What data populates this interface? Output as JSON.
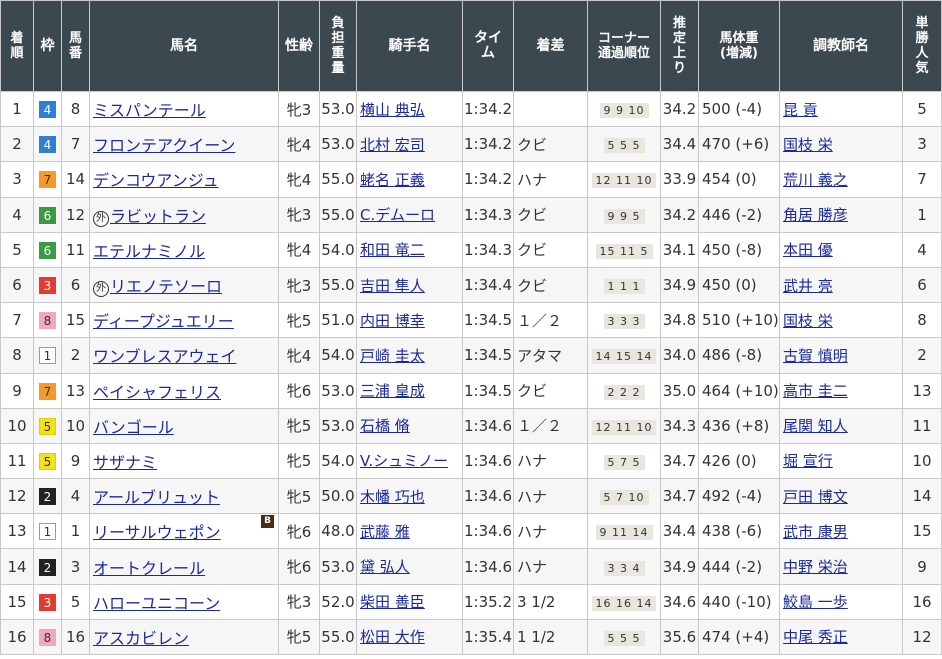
{
  "headers": {
    "rank": "着順",
    "waku": "枠",
    "umaban": "馬番",
    "horse": "馬名",
    "sexage": "性齢",
    "weight": "負担重量",
    "jockey": "騎手名",
    "time": "タイム",
    "margin": "着差",
    "corner": "コーナー通過順位",
    "last3f": "推定上り",
    "bodyweight": "馬体重(増減)",
    "trainer": "調教師名",
    "pop": "単勝人気"
  },
  "waku_colors": {
    "1": {
      "bg": "#ffffff",
      "fg": "#333333",
      "border": "#999999"
    },
    "2": {
      "bg": "#222222",
      "fg": "#ffffff",
      "border": "#222222"
    },
    "3": {
      "bg": "#e23b32",
      "fg": "#ffffff",
      "border": "#e23b32"
    },
    "4": {
      "bg": "#2f7fd7",
      "fg": "#ffffff",
      "border": "#2f7fd7"
    },
    "5": {
      "bg": "#f3e11a",
      "fg": "#333333",
      "border": "#e2cf00"
    },
    "6": {
      "bg": "#3c9a45",
      "fg": "#ffffff",
      "border": "#3c9a45"
    },
    "7": {
      "bg": "#f59a2a",
      "fg": "#333333",
      "border": "#f59a2a"
    },
    "8": {
      "bg": "#f2a6c0",
      "fg": "#333333",
      "border": "#f2a6c0"
    }
  },
  "rows": [
    {
      "rank": "1",
      "waku": "4",
      "umaban": "8",
      "horse": "ミスパンテール",
      "mark": "",
      "blinker": "",
      "sexage": "牝3",
      "weight": "53.0",
      "jockey": "横山 典弘",
      "time": "1:34.2",
      "margin": "",
      "corner": "9 9 10",
      "last3f": "34.2",
      "bodyweight": "500 (-4)",
      "trainer": "昆 貢",
      "pop": "5"
    },
    {
      "rank": "2",
      "waku": "4",
      "umaban": "7",
      "horse": "フロンテアクイーン",
      "mark": "",
      "blinker": "",
      "sexage": "牝4",
      "weight": "53.0",
      "jockey": "北村 宏司",
      "time": "1:34.2",
      "margin": "クビ",
      "corner": "5 5 5",
      "last3f": "34.4",
      "bodyweight": "470 (+6)",
      "trainer": "国枝 栄",
      "pop": "3"
    },
    {
      "rank": "3",
      "waku": "7",
      "umaban": "14",
      "horse": "デンコウアンジュ",
      "mark": "",
      "blinker": "",
      "sexage": "牝4",
      "weight": "55.0",
      "jockey": "蛯名 正義",
      "time": "1:34.2",
      "margin": "ハナ",
      "corner": "12 11 10",
      "last3f": "33.9",
      "bodyweight": "454 (0)",
      "trainer": "荒川 義之",
      "pop": "7"
    },
    {
      "rank": "4",
      "waku": "6",
      "umaban": "12",
      "horse": "ラビットラン",
      "mark": "外",
      "blinker": "",
      "sexage": "牝3",
      "weight": "55.0",
      "jockey": "C.デムーロ",
      "time": "1:34.3",
      "margin": "クビ",
      "corner": "9 9 5",
      "last3f": "34.2",
      "bodyweight": "446 (-2)",
      "trainer": "角居 勝彦",
      "pop": "1"
    },
    {
      "rank": "5",
      "waku": "6",
      "umaban": "11",
      "horse": "エテルナミノル",
      "mark": "",
      "blinker": "",
      "sexage": "牝4",
      "weight": "54.0",
      "jockey": "和田 竜二",
      "time": "1:34.3",
      "margin": "クビ",
      "corner": "15 11 5",
      "last3f": "34.1",
      "bodyweight": "450 (-8)",
      "trainer": "本田 優",
      "pop": "4"
    },
    {
      "rank": "6",
      "waku": "3",
      "umaban": "6",
      "horse": "リエノテソーロ",
      "mark": "外",
      "blinker": "",
      "sexage": "牝3",
      "weight": "55.0",
      "jockey": "吉田 隼人",
      "time": "1:34.4",
      "margin": "クビ",
      "corner": "1 1 1",
      "last3f": "34.9",
      "bodyweight": "450 (0)",
      "trainer": "武井 亮",
      "pop": "6"
    },
    {
      "rank": "7",
      "waku": "8",
      "umaban": "15",
      "horse": "ディープジュエリー",
      "mark": "",
      "blinker": "",
      "sexage": "牝5",
      "weight": "51.0",
      "jockey": "内田 博幸",
      "time": "1:34.5",
      "margin": "１／２",
      "corner": "3 3 3",
      "last3f": "34.8",
      "bodyweight": "510 (+10)",
      "trainer": "国枝 栄",
      "pop": "8"
    },
    {
      "rank": "8",
      "waku": "1",
      "umaban": "2",
      "horse": "ワンブレスアウェイ",
      "mark": "",
      "blinker": "",
      "sexage": "牝4",
      "weight": "54.0",
      "jockey": "戸崎 圭太",
      "time": "1:34.5",
      "margin": "アタマ",
      "corner": "14 15 14",
      "last3f": "34.0",
      "bodyweight": "486 (-8)",
      "trainer": "古賀 慎明",
      "pop": "2"
    },
    {
      "rank": "9",
      "waku": "7",
      "umaban": "13",
      "horse": "ペイシャフェリス",
      "mark": "",
      "blinker": "",
      "sexage": "牝6",
      "weight": "53.0",
      "jockey": "三浦 皇成",
      "time": "1:34.5",
      "margin": "クビ",
      "corner": "2 2 2",
      "last3f": "35.0",
      "bodyweight": "464 (+10)",
      "trainer": "高市 圭二",
      "pop": "13"
    },
    {
      "rank": "10",
      "waku": "5",
      "umaban": "10",
      "horse": "バンゴール",
      "mark": "",
      "blinker": "",
      "sexage": "牝5",
      "weight": "53.0",
      "jockey": "石橋 脩",
      "time": "1:34.6",
      "margin": "１／２",
      "corner": "12 11 10",
      "last3f": "34.3",
      "bodyweight": "436 (+8)",
      "trainer": "尾関 知人",
      "pop": "11"
    },
    {
      "rank": "11",
      "waku": "5",
      "umaban": "9",
      "horse": "サザナミ",
      "mark": "",
      "blinker": "",
      "sexage": "牝5",
      "weight": "54.0",
      "jockey": "V.シュミノー",
      "time": "1:34.6",
      "margin": "ハナ",
      "corner": "5 7 5",
      "last3f": "34.7",
      "bodyweight": "426 (0)",
      "trainer": "堀 宣行",
      "pop": "10"
    },
    {
      "rank": "12",
      "waku": "2",
      "umaban": "4",
      "horse": "アールブリュット",
      "mark": "",
      "blinker": "",
      "sexage": "牝5",
      "weight": "50.0",
      "jockey": "木幡 巧也",
      "time": "1:34.6",
      "margin": "ハナ",
      "corner": "5 7 10",
      "last3f": "34.7",
      "bodyweight": "492 (-4)",
      "trainer": "戸田 博文",
      "pop": "14"
    },
    {
      "rank": "13",
      "waku": "1",
      "umaban": "1",
      "horse": "リーサルウェポン",
      "mark": "",
      "blinker": "B",
      "sexage": "牝6",
      "weight": "48.0",
      "jockey": "武藤 雅",
      "time": "1:34.6",
      "margin": "ハナ",
      "corner": "9 11 14",
      "last3f": "34.4",
      "bodyweight": "438 (-6)",
      "trainer": "武市 康男",
      "pop": "15"
    },
    {
      "rank": "14",
      "waku": "2",
      "umaban": "3",
      "horse": "オートクレール",
      "mark": "",
      "blinker": "",
      "sexage": "牝6",
      "weight": "53.0",
      "jockey": "黛 弘人",
      "time": "1:34.6",
      "margin": "ハナ",
      "corner": "3 3 4",
      "last3f": "34.9",
      "bodyweight": "444 (-2)",
      "trainer": "中野 栄治",
      "pop": "9"
    },
    {
      "rank": "15",
      "waku": "3",
      "umaban": "5",
      "horse": "ハローユニコーン",
      "mark": "",
      "blinker": "",
      "sexage": "牝3",
      "weight": "52.0",
      "jockey": "柴田 善臣",
      "time": "1:35.2",
      "margin": "3 1/2",
      "corner": "16 16 14",
      "last3f": "34.6",
      "bodyweight": "440 (-10)",
      "trainer": "鮫島 一歩",
      "pop": "16"
    },
    {
      "rank": "16",
      "waku": "8",
      "umaban": "16",
      "horse": "アスカビレン",
      "mark": "",
      "blinker": "",
      "sexage": "牝5",
      "weight": "55.0",
      "jockey": "松田 大作",
      "time": "1:35.4",
      "margin": "1 1/2",
      "corner": "5 5 5",
      "last3f": "35.6",
      "bodyweight": "474 (+4)",
      "trainer": "中尾 秀正",
      "pop": "12"
    }
  ]
}
